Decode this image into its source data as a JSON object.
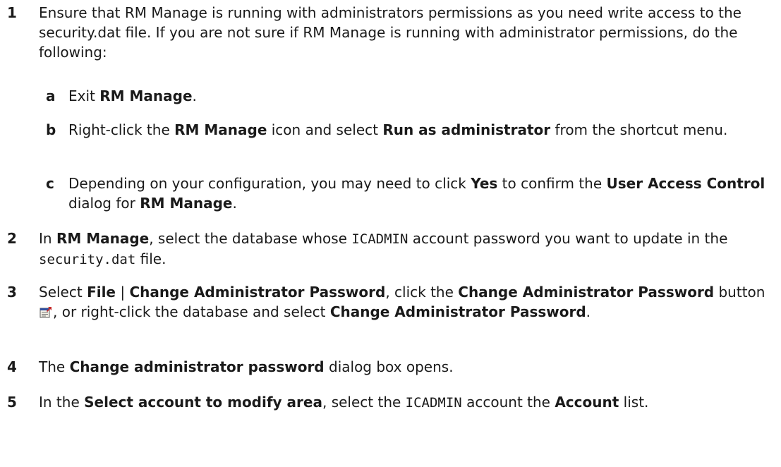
{
  "steps": [
    {
      "number": "1",
      "parts": [
        "Ensure that RM Manage is running with administrators permissions as you need write access to the security.dat file. If you are not sure if RM Manage is running with administrator permissions, do the following:"
      ],
      "substeps": [
        {
          "letter": "a",
          "p0": "Exit ",
          "b0": "RM Manage",
          "p1": "."
        },
        {
          "letter": "b",
          "p0": "Right-click the ",
          "b0": "RM Manage",
          "p1": " icon and select ",
          "b1": "Run as administrator",
          "p2": " from the shortcut menu."
        },
        {
          "letter": "c",
          "p0": "Depending on your configuration, you may need to click ",
          "b0": "Yes",
          "p1": " to confirm the ",
          "b1": "User Access Control",
          "p2": " dialog for ",
          "b2": "RM Manage",
          "p3": "."
        }
      ]
    },
    {
      "number": "2",
      "p0": "In ",
      "b0": "RM Manage",
      "p1": ", select the database whose ",
      "m0": "ICADMIN",
      "p2": " account password you want to update in the ",
      "m1": "security.dat",
      "p3": " file."
    },
    {
      "number": "3",
      "p0": "Select ",
      "b0": "File",
      "p1": " | ",
      "b1": "Change Administrator Password",
      "p2": ", click the ",
      "b2": "Change Administrator Password",
      "p3": " button ",
      "icon": "change-password-toolbar-icon",
      "p4": ", or right-click the database and select ",
      "b3": "Change Administrator Password",
      "p5": "."
    },
    {
      "number": "4",
      "p0": "The ",
      "b0": "Change administrator password",
      "p1": " dialog box opens."
    },
    {
      "number": "5",
      "p0": "In the ",
      "b0": "Select account to modify area",
      "p1": ", select the ",
      "m0": "ICADMIN",
      "p2": " account the ",
      "b1": "Account",
      "p3": " list."
    }
  ]
}
